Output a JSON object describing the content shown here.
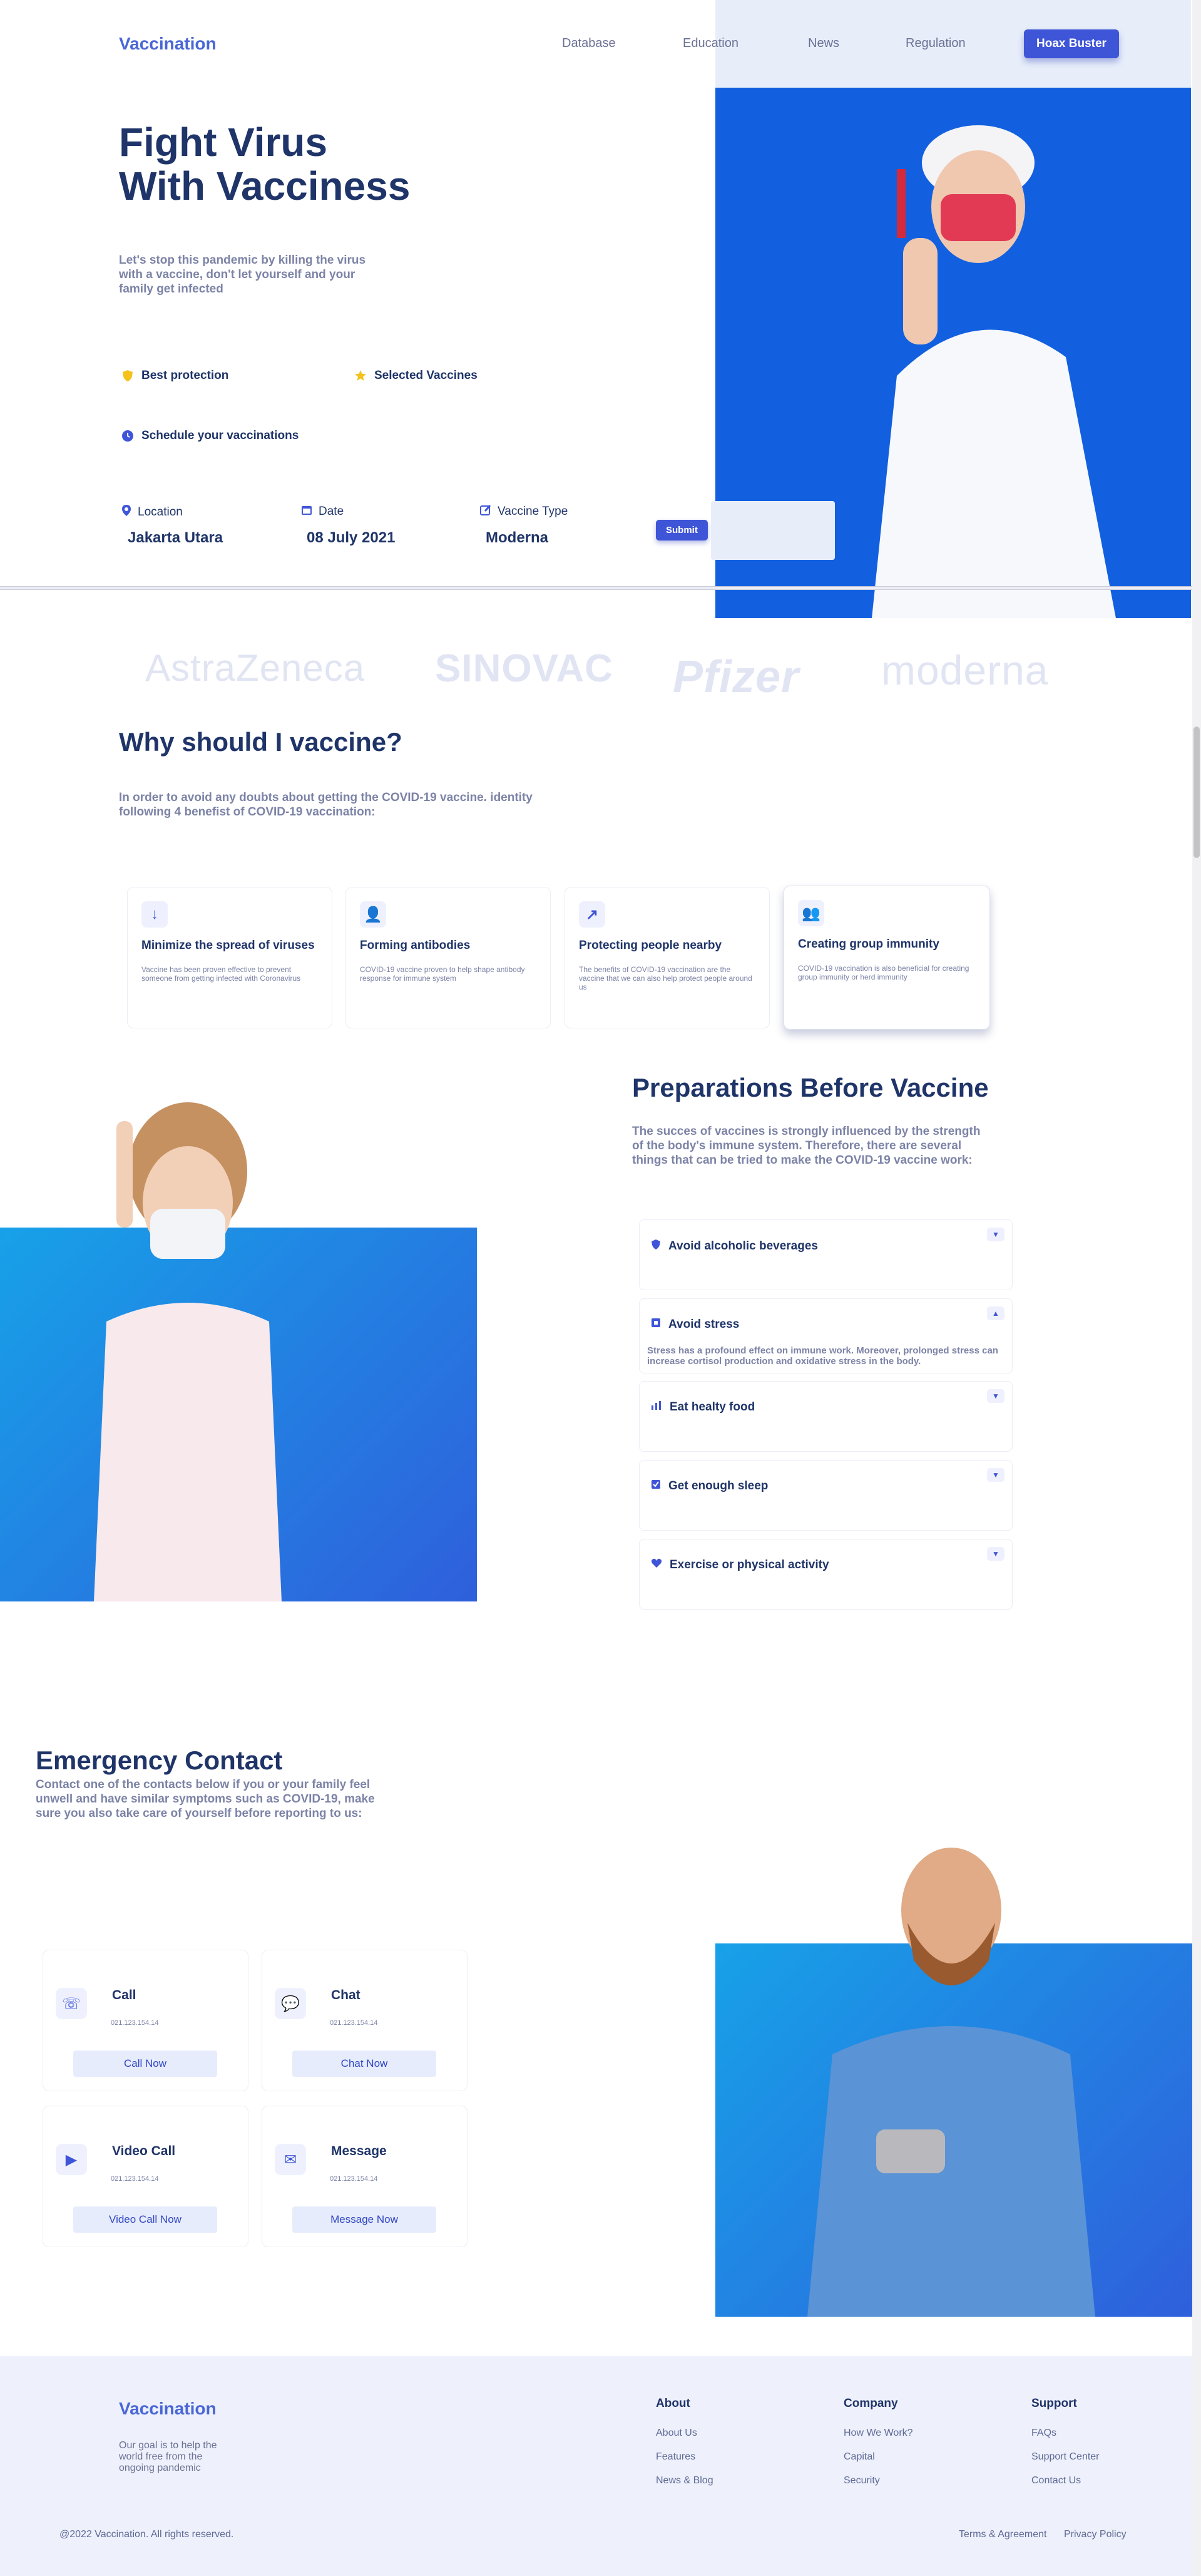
{
  "header": {
    "logo": "Vaccination",
    "nav": [
      "Database",
      "Education",
      "News",
      "Regulation"
    ],
    "cta": "Hoax Buster"
  },
  "hero": {
    "title_line1": "Fight Virus",
    "title_line2": "With Vacciness",
    "subtitle": "Let's stop this pandemic by killing the virus with a vaccine, don't let yourself and your family get infected",
    "features": [
      "Best protection",
      "Selected Vaccines",
      "Schedule your vaccinations"
    ],
    "form": {
      "location_label": "Location",
      "location_value": "Jakarta Utara",
      "date_label": "Date",
      "date_value": "08 July 2021",
      "type_label": "Vaccine Type",
      "type_value": "Moderna",
      "submit": "Submit"
    }
  },
  "brands": [
    "AstraZeneca",
    "SINOVAC",
    "Pfizer",
    "moderna"
  ],
  "why": {
    "title": "Why should I vaccine?",
    "subtitle": "In order to avoid any doubts about getting the COVID-19 vaccine. identity following 4 benefist of COVID-19 vaccination:",
    "cards": [
      {
        "title": "Minimize the spread of viruses",
        "text": "Vaccine has been proven effective to prevent someone from getting infected with Coronavirus"
      },
      {
        "title": "Forming antibodies",
        "text": "COVID-19 vaccine proven to help shape antibody response for immune system"
      },
      {
        "title": "Protecting people nearby",
        "text": "The benefits of COVID-19 vaccination are the vaccine that we can also help protect people around us"
      },
      {
        "title": "Creating group immunity",
        "text": "COVID-19 vaccination is also beneficial for creating group immunity or herd immunity"
      }
    ]
  },
  "prep": {
    "title": "Preparations Before Vaccine",
    "subtitle": "The succes of vaccines is strongly influenced by the strength of the body's immune system. Therefore, there are several things that can be tried to make the COVID-19 vaccine work:",
    "items": [
      {
        "title": "Avoid alcoholic beverages"
      },
      {
        "title": "Avoid stress",
        "text": "Stress has a profound effect on immune work. Moreover, prolonged stress can increase cortisol production and oxidative stress in the body."
      },
      {
        "title": "Eat healty food"
      },
      {
        "title": "Get enough sleep"
      },
      {
        "title": "Exercise or physical activity"
      }
    ]
  },
  "emergency": {
    "title": "Emergency Contact",
    "subtitle": "Contact one of the contacts below if you or your family feel unwell and have similar symptoms such as COVID-19, make sure you also take care of yourself before reporting to us:",
    "contacts": [
      {
        "title": "Call",
        "number": "021.123.154.14",
        "button": "Call Now"
      },
      {
        "title": "Chat",
        "number": "021.123.154.14",
        "button": "Chat Now"
      },
      {
        "title": "Video Call",
        "number": "021.123.154.14",
        "button": "Video Call Now"
      },
      {
        "title": "Message",
        "number": "021.123.154.14",
        "button": "Message Now"
      }
    ]
  },
  "footer": {
    "logo": "Vaccination",
    "tagline": "Our goal is to help the world free from the ongoing pandemic",
    "about_head": "About",
    "about_links": [
      "About Us",
      "Features",
      "News & Blog"
    ],
    "company_head": "Company",
    "company_links": [
      "How We Work?",
      "Capital",
      "Security"
    ],
    "support_head": "Support",
    "support_links": [
      "FAQs",
      "Support Center",
      "Contact Us"
    ],
    "copyright": "@2022 Vaccination. All rights reserved.",
    "terms": "Terms & Agreement",
    "privacy": "Privacy Policy"
  },
  "colors": {
    "accent": "#3f55d8",
    "navy": "#1f3468",
    "muted": "#7c83a6",
    "photo_blue": "#1260e0"
  }
}
